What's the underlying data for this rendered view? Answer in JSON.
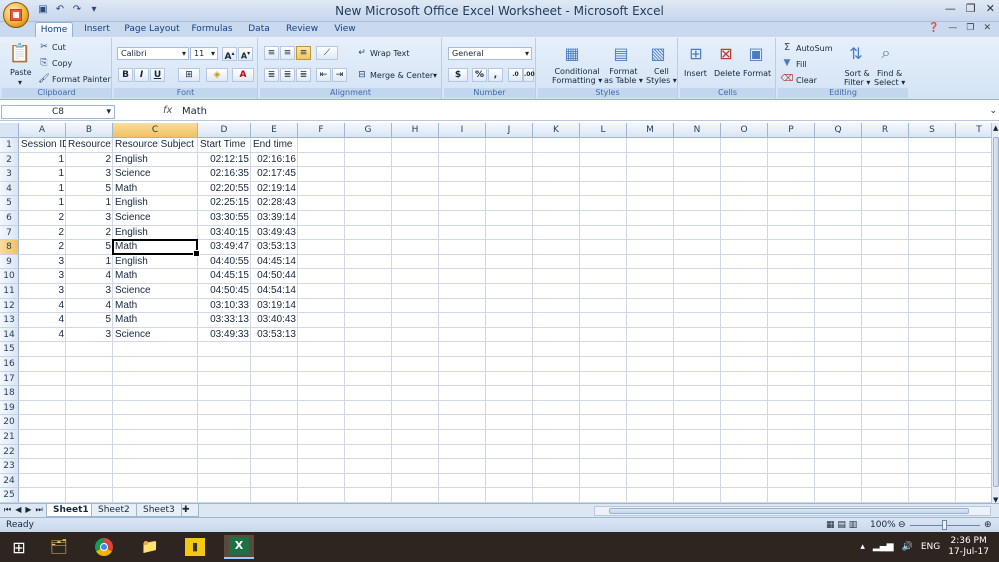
{
  "window": {
    "title": "New Microsoft Office Excel Worksheet - Microsoft Excel"
  },
  "ribbon": {
    "tabs": [
      "Home",
      "Insert",
      "Page Layout",
      "Formulas",
      "Data",
      "Review",
      "View"
    ],
    "active_tab": "Home",
    "clipboard": {
      "paste": "Paste",
      "cut": "Cut",
      "copy": "Copy",
      "format_painter": "Format Painter",
      "label": "Clipboard"
    },
    "font": {
      "family": "Calibri",
      "size": "11",
      "label": "Font"
    },
    "alignment": {
      "wrap_text": "Wrap Text",
      "merge_center": "Merge & Center",
      "label": "Alignment"
    },
    "number": {
      "format": "General",
      "currency": "$",
      "percent": "%",
      "comma": ",",
      "label": "Number"
    },
    "styles": {
      "conditional": "Conditional Formatting",
      "format_table": "Format as Table",
      "cell_styles": "Cell Styles",
      "label": "Styles"
    },
    "cells": {
      "insert": "Insert",
      "delete": "Delete",
      "format": "Format",
      "label": "Cells"
    },
    "editing": {
      "autosum": "AutoSum",
      "fill": "Fill",
      "clear": "Clear",
      "sort_filter": "Sort & Filter",
      "find_select": "Find & Select",
      "label": "Editing"
    }
  },
  "formula_bar": {
    "name_box": "C8",
    "fx": "fx",
    "value": "Math"
  },
  "columns": [
    "A",
    "B",
    "C",
    "D",
    "E",
    "F",
    "G",
    "H",
    "I",
    "J",
    "K",
    "L",
    "M",
    "N",
    "O",
    "P",
    "Q",
    "R",
    "S",
    "T"
  ],
  "active_column": "C",
  "active_row": 8,
  "rows": [
    [
      "Session ID",
      "Resource",
      "Resource Subject",
      "Start Time",
      "End time"
    ],
    [
      "1",
      "2",
      "English",
      "02:12:15",
      "02:16:16"
    ],
    [
      "1",
      "3",
      "Science",
      "02:16:35",
      "02:17:45"
    ],
    [
      "1",
      "5",
      "Math",
      "02:20:55",
      "02:19:14"
    ],
    [
      "1",
      "1",
      "English",
      "02:25:15",
      "02:28:43"
    ],
    [
      "2",
      "3",
      "Science",
      "03:30:55",
      "03:39:14"
    ],
    [
      "2",
      "2",
      "English",
      "03:40:15",
      "03:49:43"
    ],
    [
      "2",
      "5",
      "Math",
      "03:49:47",
      "03:53:13"
    ],
    [
      "3",
      "1",
      "English",
      "04:40:55",
      "04:45:14"
    ],
    [
      "3",
      "4",
      "Math",
      "04:45:15",
      "04:50:44"
    ],
    [
      "3",
      "3",
      "Science",
      "04:50:45",
      "04:54:14"
    ],
    [
      "4",
      "4",
      "Math",
      "03:10:33",
      "03:19:14"
    ],
    [
      "4",
      "5",
      "Math",
      "03:33:13",
      "03:40:43"
    ],
    [
      "4",
      "3",
      "Science",
      "03:49:33",
      "03:53:13"
    ]
  ],
  "row_count": 25,
  "sheets": [
    "Sheet1",
    "Sheet2",
    "Sheet3"
  ],
  "active_sheet": "Sheet1",
  "status": {
    "text": "Ready",
    "zoom": "100%"
  },
  "taskbar": {
    "lang": "ENG",
    "time": "2:36 PM",
    "date": "17-Jul-17"
  }
}
